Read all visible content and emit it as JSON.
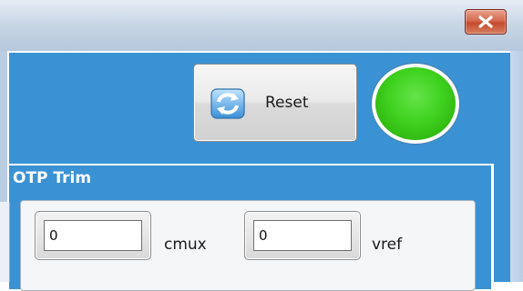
{
  "window": {
    "close_icon": "close-x-icon"
  },
  "toolbar": {
    "reset_label": "Reset",
    "reset_icon": "refresh-icon",
    "status_color": "#3fd21e"
  },
  "otp_trim": {
    "title": "OTP Trim",
    "fields": [
      {
        "value": "0",
        "label": "cmux"
      },
      {
        "value": "0",
        "label": "vref"
      }
    ]
  },
  "colors": {
    "client_bg": "#3a92d4",
    "close_button": "#c44a2b",
    "status_led": "#3fd21e"
  }
}
